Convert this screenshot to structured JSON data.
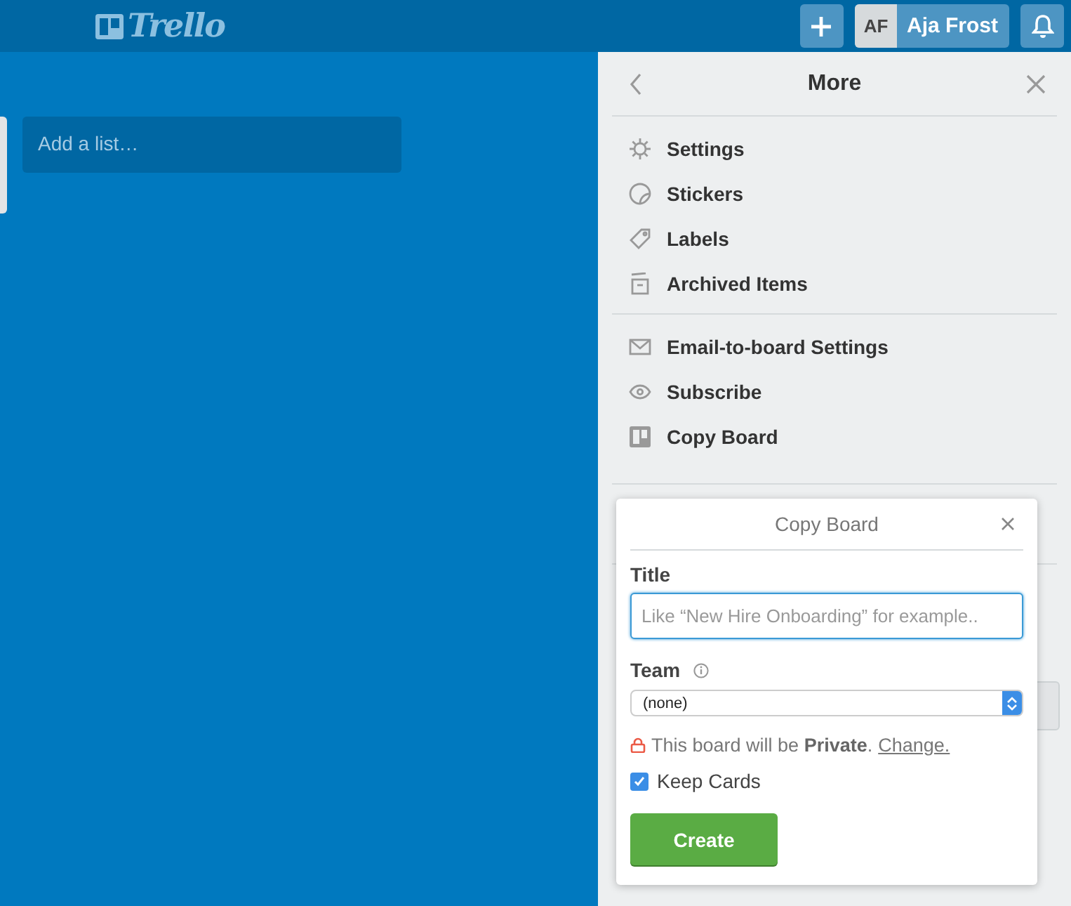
{
  "header": {
    "logo": "Trello",
    "user": {
      "initials": "AF",
      "name": "Aja Frost"
    }
  },
  "board": {
    "add_list": "Add a list…"
  },
  "sidebar": {
    "title": "More",
    "sections": [
      [
        {
          "label": "Settings",
          "kind": "gear"
        },
        {
          "label": "Stickers",
          "kind": "sticker"
        },
        {
          "label": "Labels",
          "kind": "tag"
        },
        {
          "label": "Archived Items",
          "kind": "archive"
        }
      ],
      [
        {
          "label": "Email-to-board Settings",
          "kind": "mail"
        },
        {
          "label": "Subscribe",
          "kind": "eye"
        },
        {
          "label": "Copy Board",
          "kind": "board"
        }
      ]
    ]
  },
  "popover": {
    "title": "Copy Board",
    "title_label": "Title",
    "title_placeholder": "Like “New Hire Onboarding” for example..",
    "team_label": "Team",
    "team_value": "(none)",
    "privacy": "This board will be **Private**.",
    "change_link": "Change.",
    "keep_cards": {
      "label": "Keep Cards",
      "checked": true
    },
    "button": "Create"
  }
}
